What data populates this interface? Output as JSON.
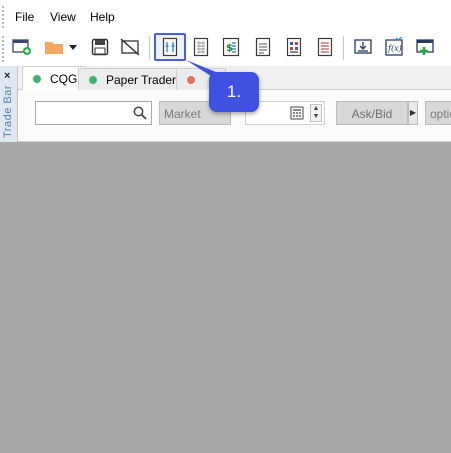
{
  "menu": {
    "file": "File",
    "view": "View",
    "help": "Help"
  },
  "toolbar": {
    "buttons": [
      {
        "name": "new-window-icon"
      },
      {
        "name": "folder-icon"
      },
      {
        "name": "dropdown-icon"
      },
      {
        "name": "save-icon"
      },
      {
        "name": "no-display-icon"
      },
      {
        "name": "order-ticket-icon",
        "highlighted": true
      },
      {
        "name": "orders-list-icon"
      },
      {
        "name": "dollar-sheet-icon"
      },
      {
        "name": "document-icon"
      },
      {
        "name": "color-grid-icon"
      },
      {
        "name": "report-icon"
      },
      {
        "name": "download-icon"
      },
      {
        "name": "formula-icon"
      },
      {
        "name": "add-window-icon"
      }
    ],
    "highlight_color": "#4a5fe0"
  },
  "trade_bar": {
    "close": "×",
    "label": "Trade Bar"
  },
  "tabs": [
    {
      "label": "CQG",
      "dot_color": "#3cb371",
      "active": true
    },
    {
      "label": "Paper Trader",
      "dot_color": "#3cb371",
      "active": false
    },
    {
      "label": "",
      "dot_color": "#e8705f",
      "active": false
    }
  ],
  "order_bar": {
    "search_value": "",
    "market_label": "Market",
    "ask_bid_label": "Ask/Bid",
    "options_label": "optio"
  },
  "callout": {
    "text": "1.",
    "color": "#3f51e0"
  }
}
